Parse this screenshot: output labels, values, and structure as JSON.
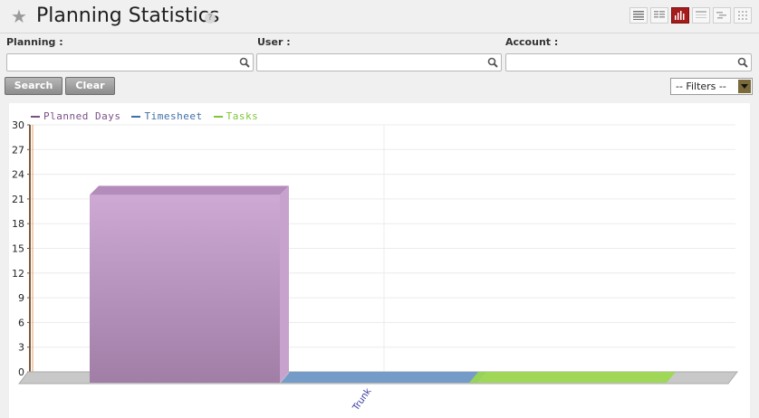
{
  "header": {
    "title": "Planning Statistics",
    "help": "?",
    "views": [
      "list-view-icon",
      "detail-view-icon",
      "graph-view-icon",
      "calendar-view-icon",
      "gantt-view-icon",
      "grid-view-icon"
    ],
    "active_view": "graph-view-icon"
  },
  "search": {
    "fields": [
      {
        "label": "Planning :",
        "value": ""
      },
      {
        "label": "User :",
        "value": ""
      },
      {
        "label": "Account :",
        "value": ""
      }
    ],
    "search_button": "Search",
    "clear_button": "Clear",
    "filters_select": "-- Filters --"
  },
  "colors": {
    "planned_days": "#c4a6cc",
    "timesheet": "#6c97c8",
    "tasks": "#9bd84d",
    "active_view": "#a61c1c"
  },
  "chart_data": {
    "type": "bar",
    "categories": [
      "Trunk"
    ],
    "series": [
      {
        "name": "Planned Days",
        "values": [
          21.5
        ]
      },
      {
        "name": "Timesheet",
        "values": [
          0
        ]
      },
      {
        "name": "Tasks",
        "values": [
          0
        ]
      }
    ],
    "yticks": [
      "0",
      "3",
      "6",
      "9",
      "12",
      "15",
      "18",
      "21",
      "24",
      "27",
      "30"
    ],
    "ylim": [
      0,
      30
    ],
    "legend_position": "top-left",
    "grid": true
  }
}
